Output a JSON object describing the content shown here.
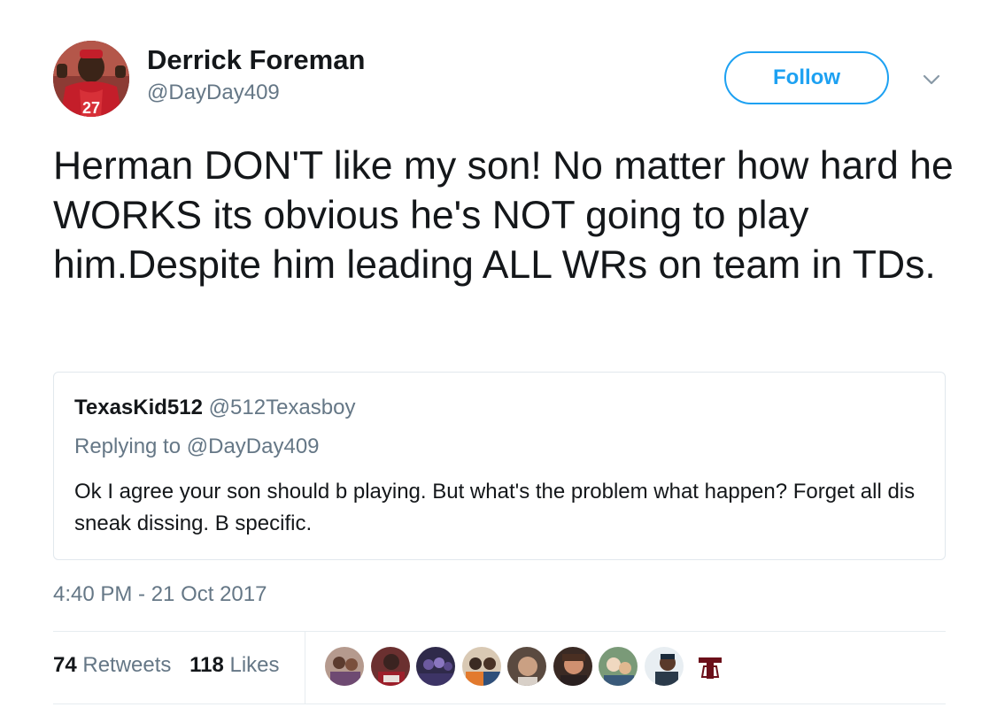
{
  "author": {
    "display_name": "Derrick Foreman",
    "handle": "@DayDay409"
  },
  "follow_label": "Follow",
  "tweet_text": "Herman DON'T like my son! No matter how hard he WORKS its obvious he's NOT going to play him.Despite him leading ALL WRs on team in TDs.",
  "quoted": {
    "display_name": "TexasKid512",
    "handle": "@512Texasboy",
    "replying_prefix": "Replying to",
    "replying_to": "@DayDay409",
    "text": "Ok I agree your son should b playing. But what's the problem what happen? Forget all dis sneak dissing. B specific."
  },
  "timestamp": "4:40 PM - 21 Oct 2017",
  "stats": {
    "retweets_count": "74",
    "retweets_label": "Retweets",
    "likes_count": "118",
    "likes_label": "Likes"
  },
  "colors": {
    "accent": "#1da1f2",
    "secondary_text": "#657786",
    "border": "#e1e8ed"
  },
  "icons": {
    "caret": "chevron-down-icon"
  }
}
